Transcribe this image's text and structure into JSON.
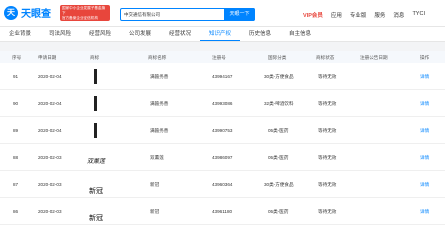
{
  "header": {
    "logo_mark": "天",
    "logo_text": "天眼查",
    "promo_line1": "国家中小企业发展子基金旗下",
    "promo_line2": "官方备案企业征信机构",
    "search_value": "中交通信有限公司",
    "search_button": "天眼一下",
    "nav": [
      "VIP会员",
      "应用",
      "专业版",
      "服务",
      "消息",
      "TYCI"
    ]
  },
  "tabs": [
    "企业背景",
    "司法风险",
    "经营风险",
    "公司发展",
    "经营状况",
    "知识产权",
    "历史信息",
    "自主信息"
  ],
  "active_tab_index": 5,
  "tab_badges": [
    "",
    "",
    "",
    "",
    "",
    "",
    "",
    ""
  ],
  "table": {
    "columns": [
      "序号",
      "申请日期",
      "商标",
      "商标名称",
      "注册号",
      "国际分类",
      "商标状态",
      "注册公告日期",
      "操作"
    ],
    "rows": [
      {
        "index": "91",
        "date": "2020-02-04",
        "name": "满箍务善",
        "reg": "43994167",
        "class": "30类-方便食品",
        "status": "等待无效",
        "action": "详情"
      },
      {
        "index": "90",
        "date": "2020-02-04",
        "name": "满箍务善",
        "reg": "43993086",
        "class": "32类-啤酒饮料",
        "status": "等待无效",
        "action": "详情"
      },
      {
        "index": "89",
        "date": "2020-02-04",
        "name": "满箍务善",
        "reg": "43990753",
        "class": "05类-医药",
        "status": "等待无效",
        "action": "详情"
      },
      {
        "index": "88",
        "date": "2020-02-03",
        "name": "双薰莲",
        "reg": "43986097",
        "class": "05类-医药",
        "status": "等待无效",
        "action": "详情"
      },
      {
        "index": "87",
        "date": "2020-02-03",
        "name": "新冠",
        "reg": "43960364",
        "class": "30类-方便食品",
        "status": "等待无效",
        "action": "详情"
      },
      {
        "index": "86",
        "date": "2020-02-03",
        "name": "新冠",
        "reg": "43961180",
        "class": "05类-医药",
        "status": "等待无效",
        "action": "详情"
      }
    ],
    "thumb_text": [
      "",
      "",
      "",
      "双薰莲",
      "新冠",
      "新冠"
    ]
  }
}
